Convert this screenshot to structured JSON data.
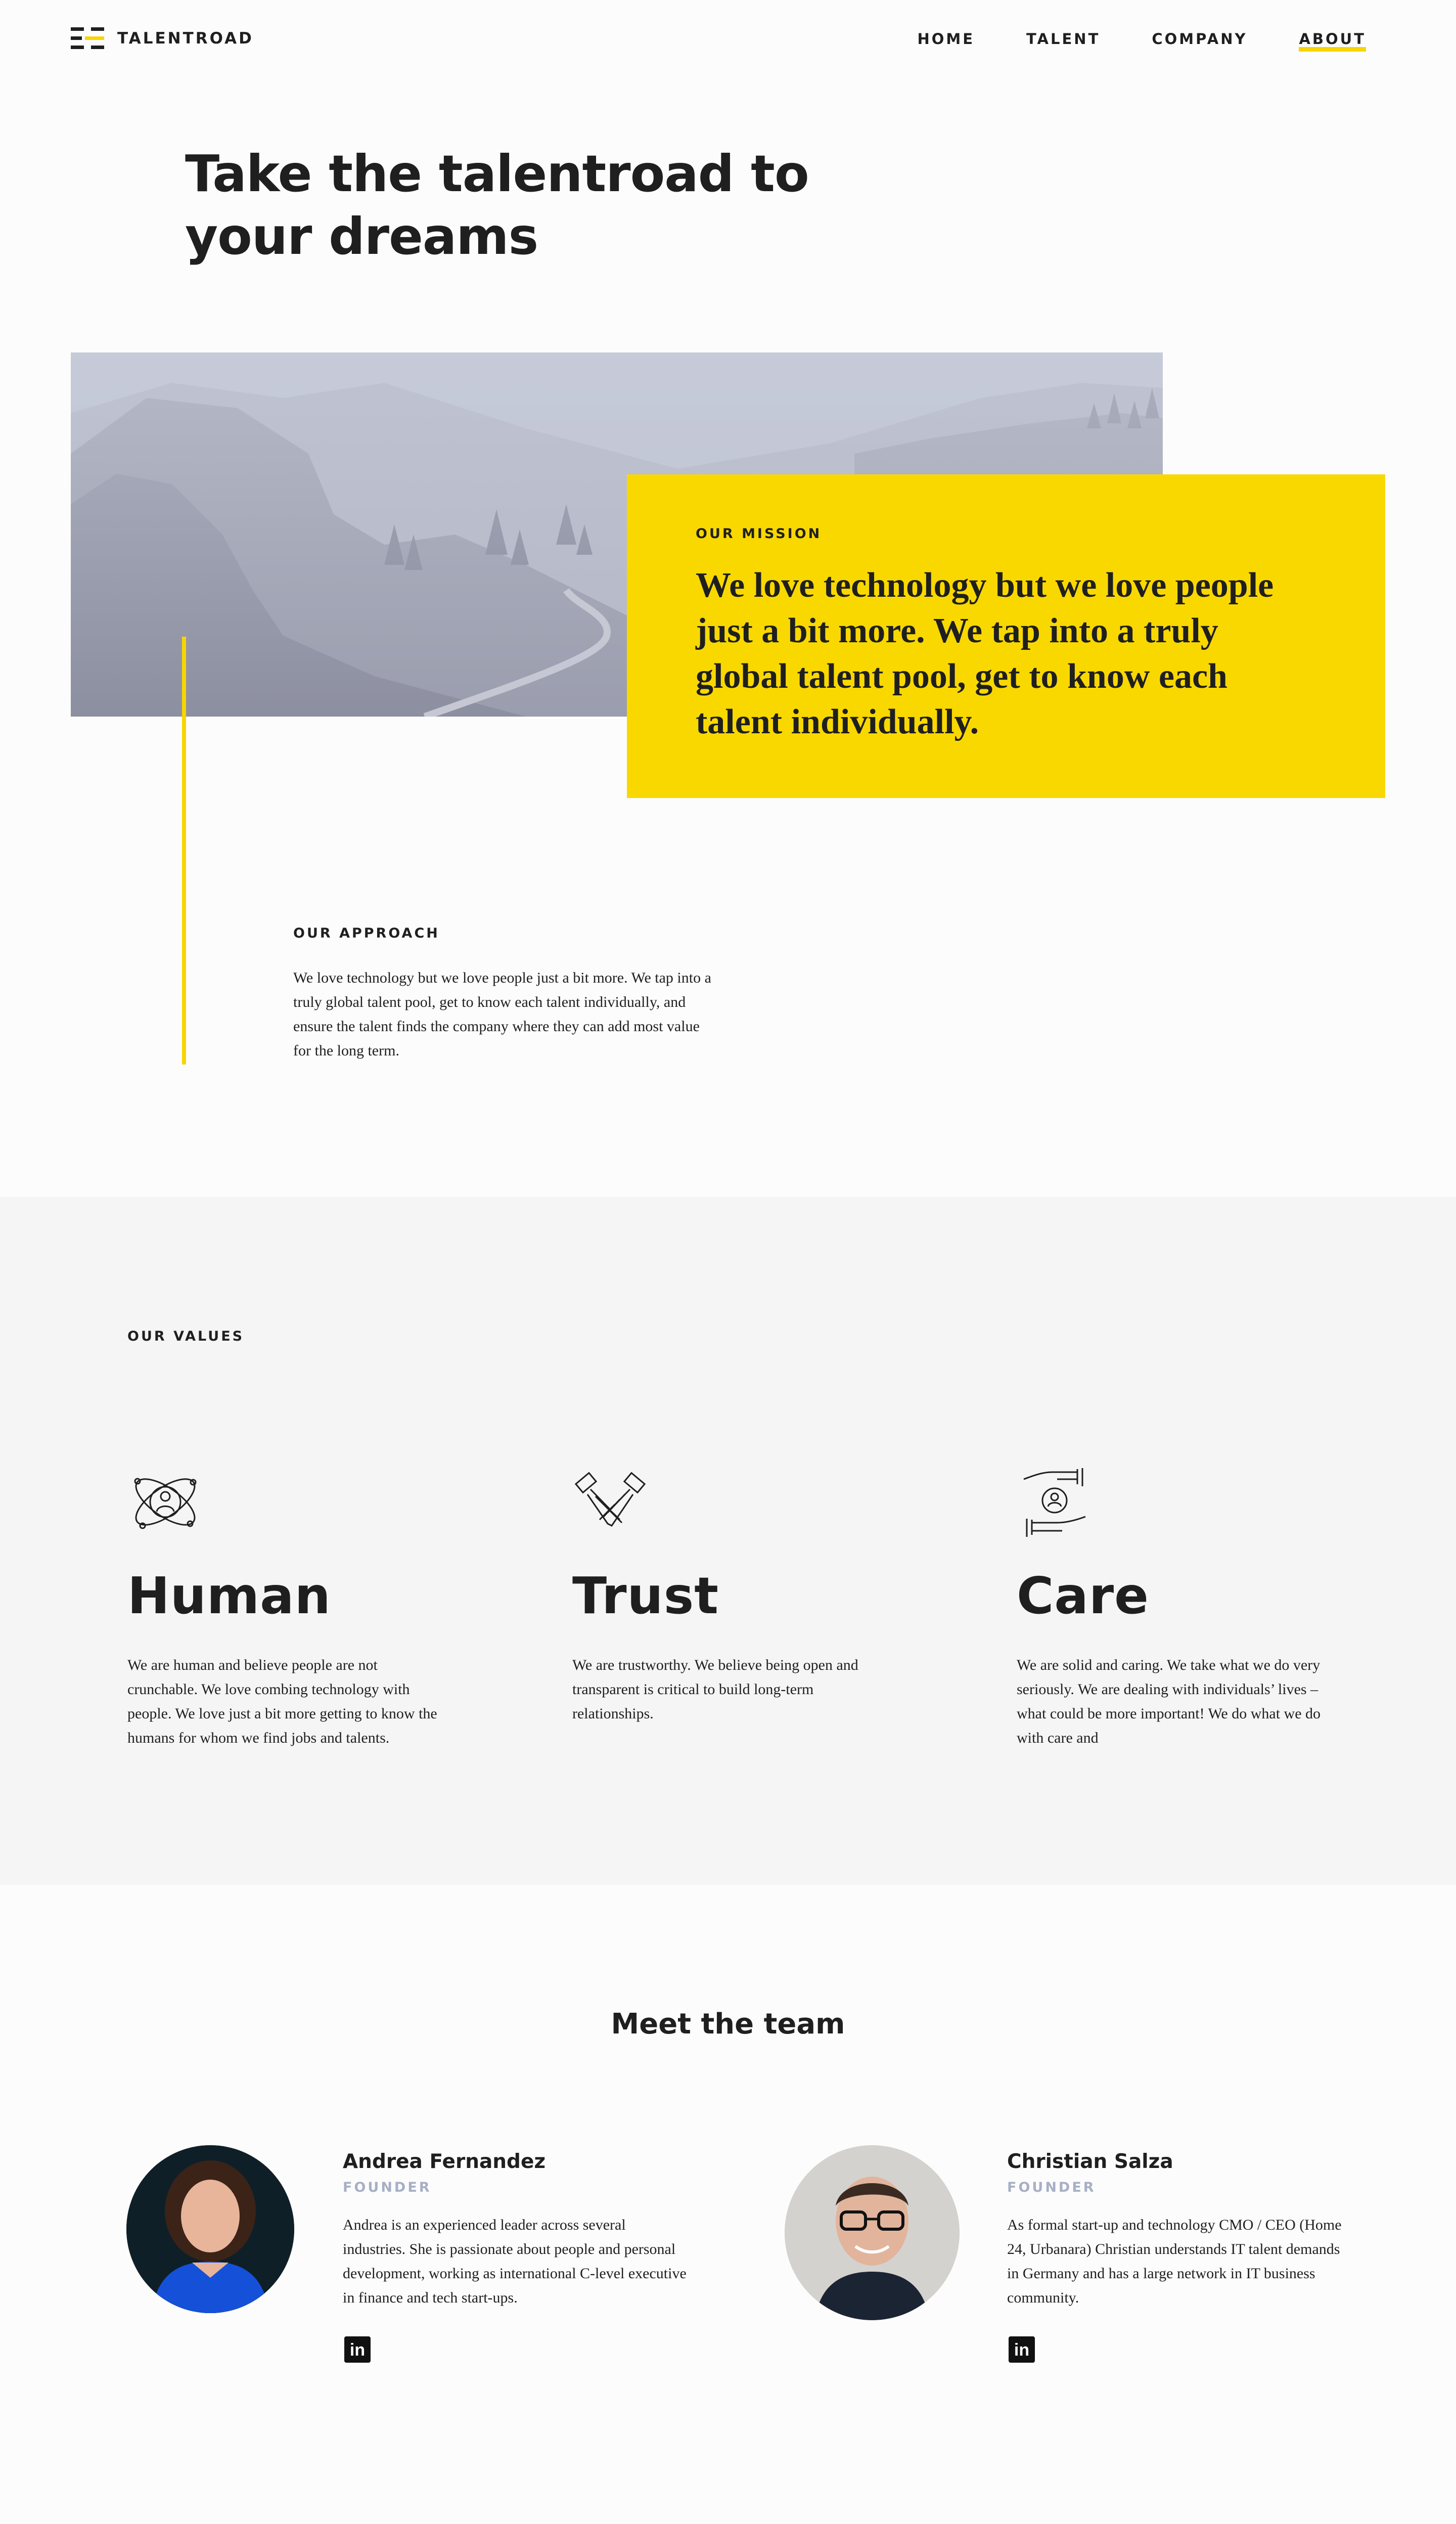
{
  "header": {
    "logo_text": "TALENTROAD",
    "nav": [
      "HOME",
      "TALENT",
      "COMPANY",
      "ABOUT"
    ],
    "active_nav": "ABOUT"
  },
  "hero": {
    "title_line1": "Take the talentroad to",
    "title_line2": "your dreams"
  },
  "mission": {
    "label": "OUR MISSION",
    "text": "We love technology but we love people just a bit more. We tap into a truly global talent pool, get to know each talent individually."
  },
  "approach": {
    "label": "OUR APPROACH",
    "text": "We love technology but we love people just a bit more. We tap into a truly global talent pool, get to know each talent individually, and ensure the talent finds the company where they can add most value for the long term."
  },
  "values": {
    "label": "OUR VALUES",
    "items": [
      {
        "title": "Human",
        "icon": "atom-person-icon",
        "text": "We are human and believe people are not crunchable. We love combing technology with people. We love just a bit more getting to know the humans for whom we find jobs and talents."
      },
      {
        "title": "Trust",
        "icon": "handshake-icon",
        "text": "We are trustworthy. We believe being open and transparent is critical to build long-term relationships."
      },
      {
        "title": "Care",
        "icon": "hands-person-icon",
        "text": "We are solid and caring. We take what we do very seriously. We are dealing with individuals’ lives – what could be more important! We do what we do with care and"
      }
    ]
  },
  "team": {
    "title": "Meet the team",
    "members": [
      {
        "name": "Andrea Fernandez",
        "role": "FOUNDER",
        "bio": "Andrea is an experienced leader across several industries. She is passionate about people and personal development, working as international C-level executive in finance and tech start-ups.",
        "social": "in"
      },
      {
        "name": "Christian Salza",
        "role": "FOUNDER",
        "bio": "As formal start-up and technology CMO / CEO (Home 24, Urbanara) Christian understands IT talent demands in Germany and has a large network in IT business community.",
        "social": "in"
      }
    ]
  },
  "colors": {
    "accent": "#f9d800",
    "text": "#1f1f1f",
    "muted": "#a7afc5",
    "section_bg": "#f5f5f5"
  }
}
